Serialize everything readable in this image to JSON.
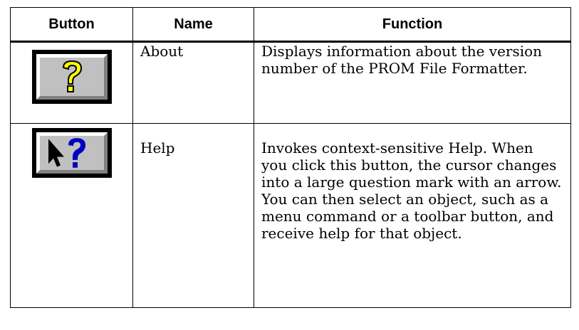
{
  "table": {
    "headers": [
      "Button",
      "Name",
      "Function"
    ],
    "rows": [
      {
        "icon": "about-question-mark-icon",
        "name": "About",
        "function": "Displays information about the version number of the PROM File Formatter."
      },
      {
        "icon": "help-arrow-question-icon",
        "name": "Help",
        "function": "Invokes context-sensitive Help. When you click this button, the cursor changes into a large question mark with an arrow. You can then select an object, such as a menu command or a toolbar button, and receive help for that object."
      }
    ]
  },
  "colors": {
    "button_face": "#c0c0c0",
    "question_yellow": "#ffff00",
    "question_blue": "#0000c0"
  }
}
